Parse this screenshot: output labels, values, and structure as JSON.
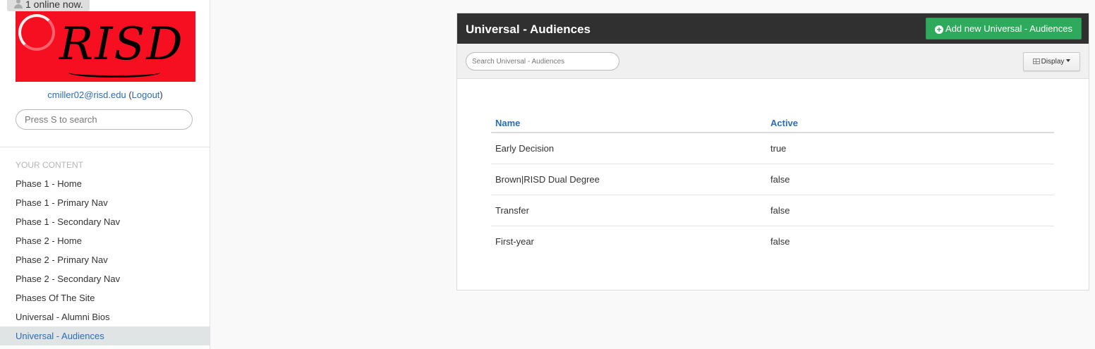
{
  "presence": {
    "online_text": "1 online now."
  },
  "logo": {
    "text": "RISD"
  },
  "user": {
    "email": "cmiller02@risd.edu",
    "logout_label": "Logout"
  },
  "sidebar": {
    "search_placeholder": "Press S to search",
    "section_label": "YOUR CONTENT",
    "items": [
      {
        "label": "Phase 1 - Home"
      },
      {
        "label": "Phase 1 - Primary Nav"
      },
      {
        "label": "Phase 1 - Secondary Nav"
      },
      {
        "label": "Phase 2 - Home"
      },
      {
        "label": "Phase 2 - Primary Nav"
      },
      {
        "label": "Phase 2 - Secondary Nav"
      },
      {
        "label": "Phases Of The Site"
      },
      {
        "label": "Universal - Alumni Bios"
      },
      {
        "label": "Universal - Audiences",
        "active": true
      }
    ]
  },
  "panel": {
    "title": "Universal - Audiences",
    "add_button_label": "Add new Universal - Audiences",
    "search_placeholder": "Search Universal - Audiences",
    "display_button_label": "Display"
  },
  "table": {
    "columns": [
      "Name",
      "Active"
    ],
    "rows": [
      {
        "name": "Early Decision",
        "active": "true"
      },
      {
        "name": "Brown|RISD Dual Degree",
        "active": "false"
      },
      {
        "name": "Transfer",
        "active": "false"
      },
      {
        "name": "First-year",
        "active": "false"
      }
    ]
  },
  "colors": {
    "brand_red": "#f50f20",
    "link_blue": "#2a6cb6",
    "add_green": "#2eaa5c",
    "header_dark": "#303030"
  },
  "icons": [
    "user-icon",
    "spinner-icon",
    "plus-circle-icon",
    "grid-icon",
    "caret-down-icon"
  ]
}
